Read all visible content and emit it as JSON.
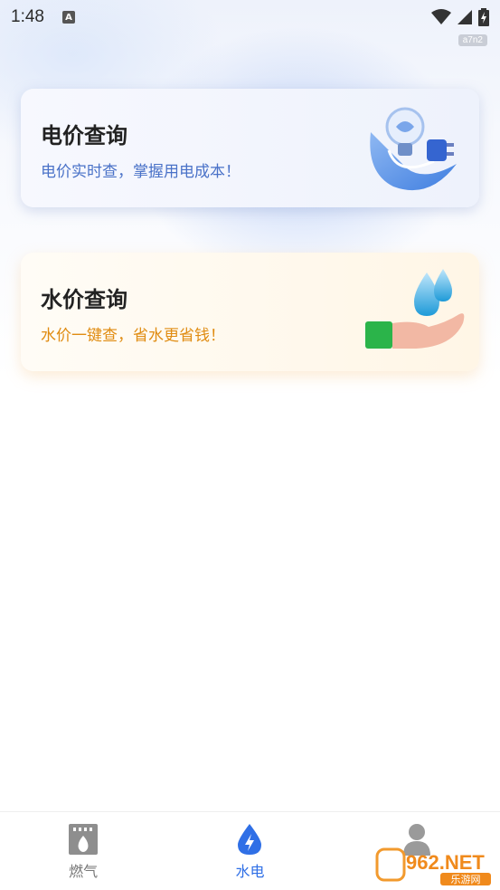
{
  "status_bar": {
    "time": "1:48",
    "notification_icon": "A",
    "icons": [
      "wifi-icon",
      "signal-icon",
      "battery-charging-icon"
    ]
  },
  "badge": "a7n2",
  "cards": {
    "electricity": {
      "title": "电价查询",
      "subtitle": "电价实时查，掌握用电成本！",
      "subtitle_color": "#4a72c8",
      "icon": "plug-bulb-icon"
    },
    "water": {
      "title": "水价查询",
      "subtitle": "水价一键查，省水更省钱！",
      "subtitle_color": "#e08c12",
      "icon": "water-drop-hand-icon"
    }
  },
  "bottom_nav": {
    "items": [
      {
        "label": "燃气",
        "icon": "gas-stove-icon",
        "active": false
      },
      {
        "label": "水电",
        "icon": "water-drop-bolt-icon",
        "active": true
      },
      {
        "label": "",
        "icon": "profile-icon",
        "active": false
      }
    ],
    "accent": "#2f6fe6"
  },
  "watermark": {
    "text": "962.NET",
    "subtext": "乐游网"
  }
}
